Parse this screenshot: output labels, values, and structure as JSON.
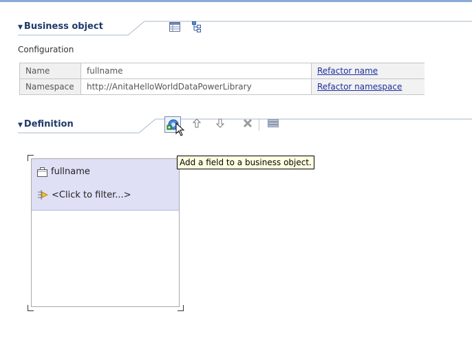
{
  "business_object": {
    "title": "Business object",
    "configuration_label": "Configuration",
    "rows": [
      {
        "key": "Name",
        "value": "fullname",
        "link": "Refactor name"
      },
      {
        "key": "Namespace",
        "value": "http://AnitaHelloWorldDataPowerLibrary",
        "link": "Refactor namespace"
      }
    ]
  },
  "definition": {
    "title": "Definition",
    "tooltip": "Add a field to a business object.",
    "object_name": "fullname",
    "filter_text": "<Click to filter...>"
  },
  "icons": {
    "table_view": "table-view-icon",
    "tree_view": "tree-view-icon",
    "add_field": "add-field-icon",
    "move_up": "move-up-icon",
    "move_down": "move-down-icon",
    "delete": "delete-icon",
    "layout": "layout-icon"
  },
  "colors": {
    "header_text": "#1f3a68",
    "box_header": "#dfe0f5",
    "link": "#1a2f9e",
    "tooltip_bg": "#ffffe1"
  }
}
